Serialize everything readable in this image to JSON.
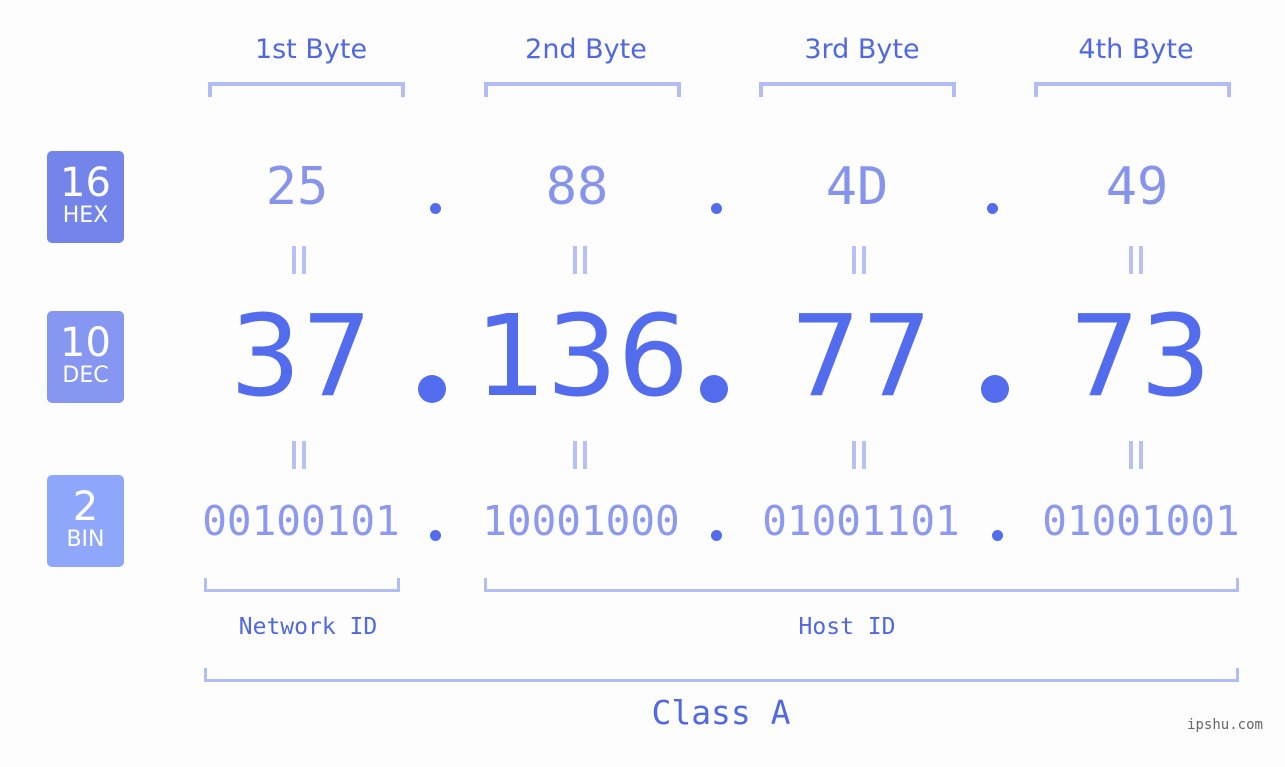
{
  "colors": {
    "accent": "#536ced",
    "header_text": "#5068e1",
    "hex_text": "#8794ec",
    "bin_text": "#8c99ef",
    "bracket": "#b2bcf7",
    "equals": "#b7c1f5",
    "badge_hex": "#7385ea",
    "badge_dec": "#8597f1",
    "badge_bin": "#8fa7fa",
    "background": "#fcfdfc"
  },
  "badges": {
    "hex": {
      "base": "16",
      "label": "HEX"
    },
    "dec": {
      "base": "10",
      "label": "DEC"
    },
    "bin": {
      "base": "2",
      "label": "BIN"
    }
  },
  "byte_headers": [
    "1st Byte",
    "2nd Byte",
    "3rd Byte",
    "4th Byte"
  ],
  "separator": ".",
  "equals_symbol": "=",
  "hex": [
    "25",
    "88",
    "4D",
    "49"
  ],
  "dec": [
    "37",
    "136",
    "77",
    "73"
  ],
  "bin": [
    "00100101",
    "10001000",
    "01001101",
    "01001001"
  ],
  "segments": {
    "network_id": "Network ID",
    "host_id": "Host ID"
  },
  "ip_class": "Class A",
  "watermark": "ipshu.com"
}
